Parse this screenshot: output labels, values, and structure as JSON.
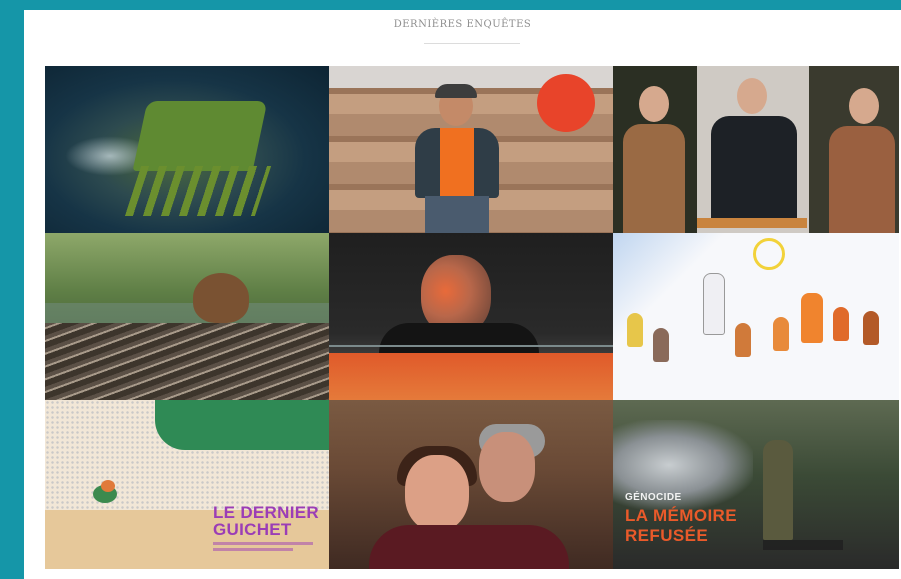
{
  "section": {
    "title": "DERNIÈRES ENQUÊTES"
  },
  "tiles": [
    {
      "name": "tile-machine-water",
      "caption": ""
    },
    {
      "name": "tile-lumberjack-logs",
      "caption": ""
    },
    {
      "name": "tile-three-portraits",
      "caption": ""
    },
    {
      "name": "tile-beaver",
      "caption": ""
    },
    {
      "name": "tile-man-dark",
      "caption": ""
    },
    {
      "name": "tile-child-drawing",
      "caption": ""
    },
    {
      "name": "tile-le-dernier-guichet",
      "caption_line1": "LE DERNIER",
      "caption_line2": "GUICHET"
    },
    {
      "name": "tile-women-hugging",
      "caption": ""
    },
    {
      "name": "tile-la-memoire-refusee",
      "caption_top": "GÉNOCIDE",
      "caption_line1": "LA MÉMOIRE",
      "caption_line2": "REFUSÉE"
    }
  ],
  "colors": {
    "frame": "#1596a8",
    "title": "#8e8e8e",
    "guichet_text": "#9b3db6",
    "memoire_text": "#ea5a2a"
  }
}
